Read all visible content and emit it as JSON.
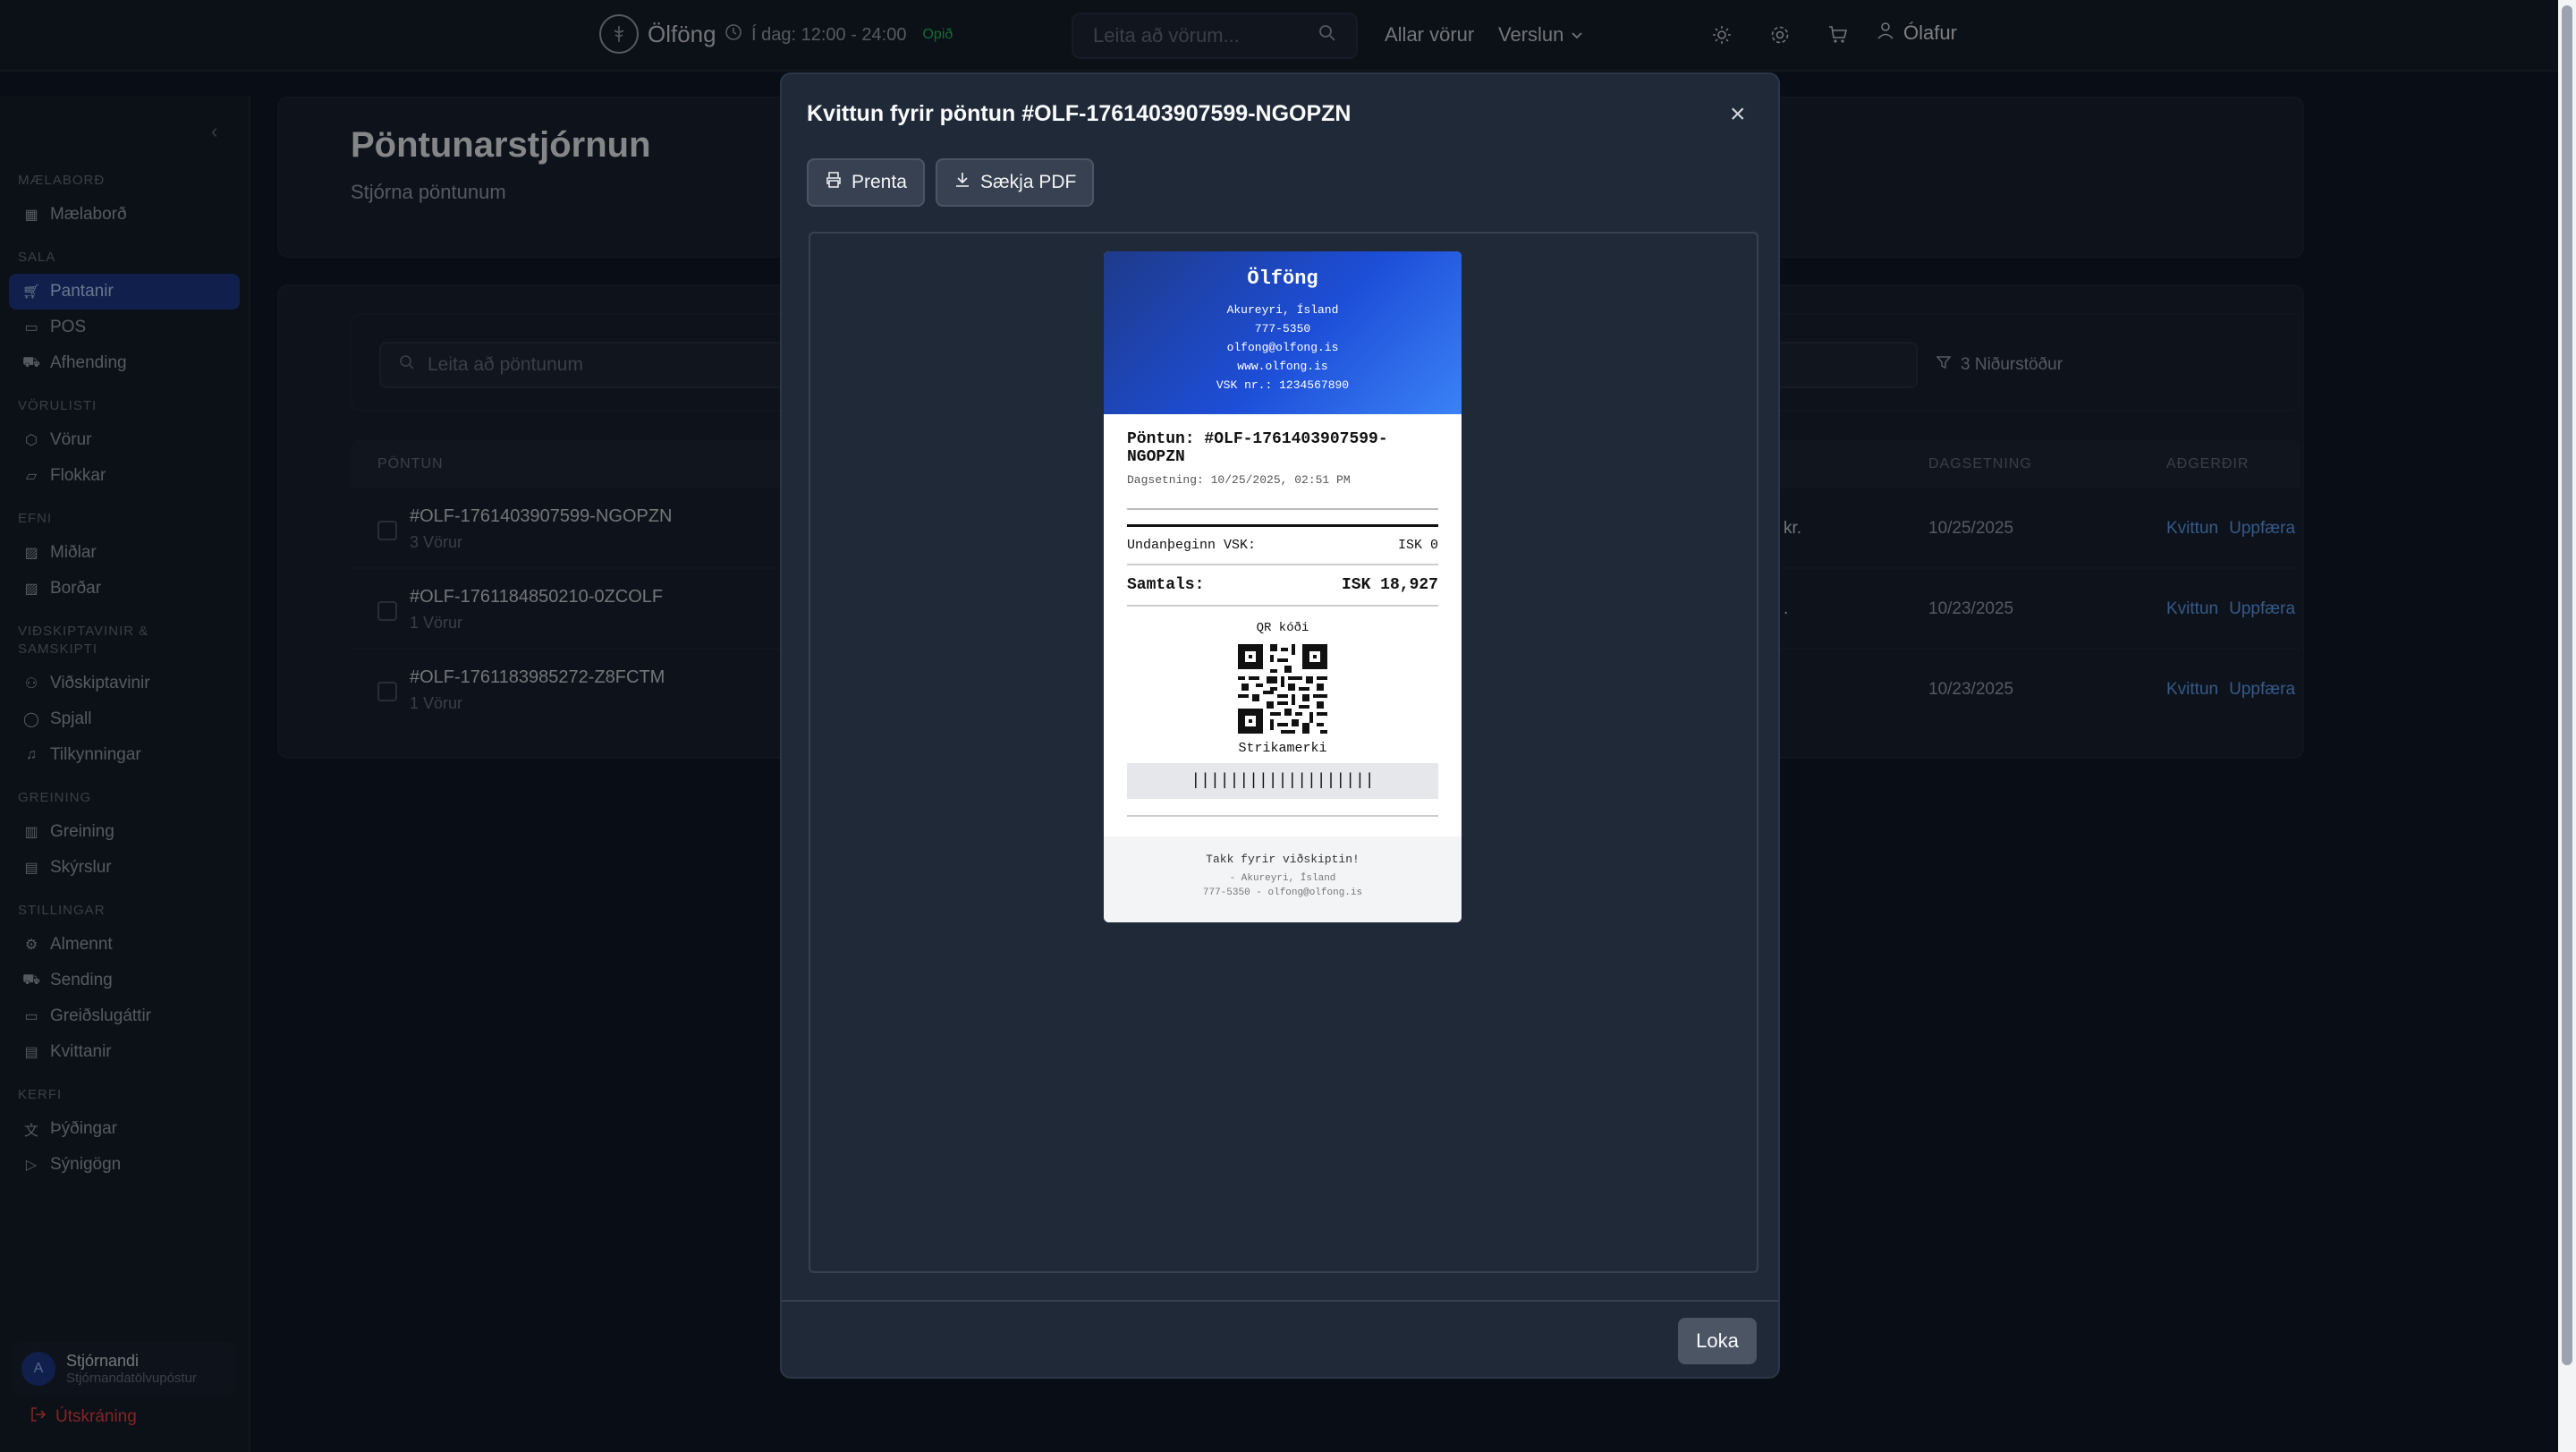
{
  "topnav": {
    "brand": "Ölföng",
    "hours": "Í dag: 12:00 - 24:00",
    "open_status": "Opið",
    "search_placeholder": "Leita að vörum...",
    "all_products": "Allar vörur",
    "shop": "Verslun",
    "user": "Ólafur"
  },
  "sidebar": {
    "sections": [
      {
        "title": "Mælaborð",
        "items": [
          {
            "label": "Mælaborð",
            "icon": "dashboard-icon"
          }
        ]
      },
      {
        "title": "Sala",
        "items": [
          {
            "label": "Pantanir",
            "icon": "cart-icon"
          },
          {
            "label": "POS",
            "icon": "pos-icon"
          },
          {
            "label": "Afhending",
            "icon": "truck-icon"
          }
        ]
      },
      {
        "title": "Vörulisti",
        "items": [
          {
            "label": "Vörur",
            "icon": "box-icon"
          },
          {
            "label": "Flokkar",
            "icon": "folder-icon"
          }
        ]
      },
      {
        "title": "Efni",
        "items": [
          {
            "label": "Miðlar",
            "icon": "image-icon"
          },
          {
            "label": "Borðar",
            "icon": "banner-icon"
          }
        ]
      },
      {
        "title": "Viðskiptavinir & Samskipti",
        "items": [
          {
            "label": "Viðskiptavinir",
            "icon": "users-icon"
          },
          {
            "label": "Spjall",
            "icon": "chat-icon"
          },
          {
            "label": "Tilkynningar",
            "icon": "bell-icon"
          }
        ]
      },
      {
        "title": "Greining",
        "items": [
          {
            "label": "Greining",
            "icon": "chart-icon"
          },
          {
            "label": "Skýrslur",
            "icon": "report-icon"
          }
        ]
      },
      {
        "title": "Stillingar",
        "items": [
          {
            "label": "Almennt",
            "icon": "gear-icon"
          },
          {
            "label": "Sending",
            "icon": "truck-icon"
          },
          {
            "label": "Greiðslugáttir",
            "icon": "card-icon"
          },
          {
            "label": "Kvittanir",
            "icon": "receipt-icon"
          }
        ]
      },
      {
        "title": "Kerfi",
        "items": [
          {
            "label": "Þýðingar",
            "icon": "translate-icon"
          },
          {
            "label": "Sýnigögn",
            "icon": "play-icon"
          }
        ]
      }
    ],
    "user_name": "Stjórnandi",
    "user_email": "Stjórnandatölvupóstur",
    "avatar_letter": "A",
    "logout": "Útskráning"
  },
  "page": {
    "title": "Pöntunarstjórnun",
    "subtitle": "Stjórna pöntunum",
    "search_placeholder": "Leita að pöntunum",
    "results": "3 Niðurstöður",
    "columns": {
      "order": "Pöntun",
      "date": "Dagsetning",
      "actions": "Aðgerðir"
    },
    "rows": [
      {
        "code": "#OLF-1761403907599-NGOPZN",
        "count": "3 Vörur",
        "amount": "kr.",
        "date": "10/25/2025",
        "receipt": "Kvittun",
        "update": "Uppfæra"
      },
      {
        "code": "#OLF-1761184850210-0ZCOLF",
        "count": "1 Vörur",
        "amount": ".",
        "date": "10/23/2025",
        "receipt": "Kvittun",
        "update": "Uppfæra"
      },
      {
        "code": "#OLF-1761183985272-Z8FCTM",
        "count": "1 Vörur",
        "amount": "",
        "date": "10/23/2025",
        "receipt": "Kvittun",
        "update": "Uppfæra"
      }
    ]
  },
  "modal": {
    "title": "Kvittun fyrir pöntun #OLF-1761403907599-NGOPZN",
    "print": "Prenta",
    "download_pdf": "Sækja PDF",
    "close": "Loka"
  },
  "receipt": {
    "store": "Ölföng",
    "address": "Akureyri, Ísland",
    "phone": "777-5350",
    "email": "olfong@olfong.is",
    "website": "www.olfong.is",
    "vat_no": "VSK nr.: 1234567890",
    "order": "Pöntun: #OLF-1761403907599-NGOPZN",
    "date": "Dagsetning: 10/25/2025, 02:51 PM",
    "vat_label": "Undanþeginn VSK:",
    "vat_value": "ISK 0",
    "total_label": "Samtals:",
    "total_value": "ISK 18,927",
    "qr_label": "QR kóði",
    "barcode_label": "Strikamerki",
    "barcode": "|||||||||||||||||||",
    "thanks": "Takk fyrir viðskiptin!",
    "footer_line1": "- Akureyri, Ísland",
    "footer_line2": "777-5350 - olfong@olfong.is"
  },
  "colors": {
    "accent": "#1e3a8a",
    "link": "#60a5fa",
    "open": "#22c55e",
    "logout": "#ef4444"
  }
}
